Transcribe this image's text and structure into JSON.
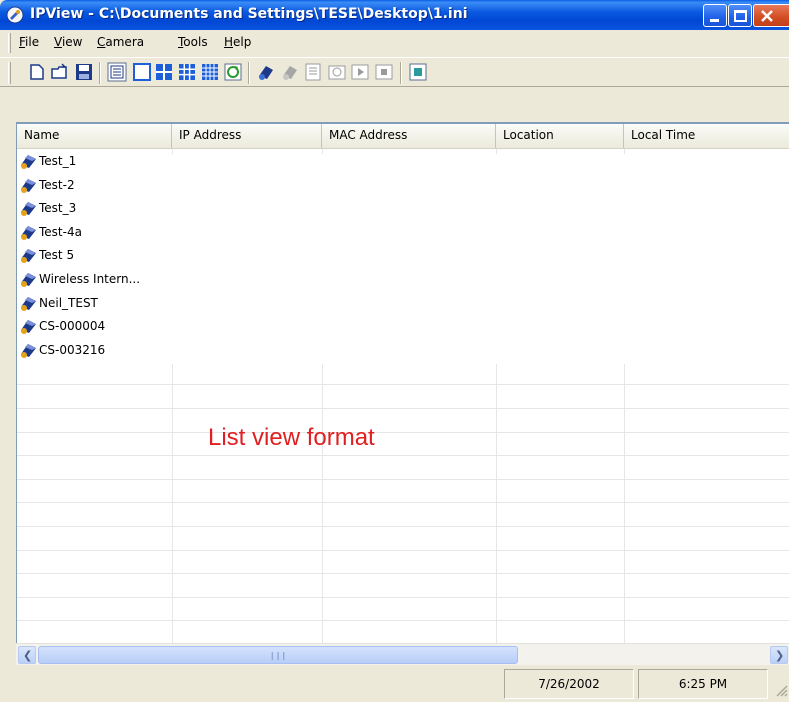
{
  "window": {
    "title": "IPView - C:\\Documents and Settings\\TESE\\Desktop\\1.ini"
  },
  "menu": {
    "items": [
      {
        "label": "File",
        "accel": "F",
        "rest": "ile"
      },
      {
        "label": "View",
        "accel": "V",
        "rest": "iew"
      },
      {
        "label": "Camera",
        "accel": "C",
        "rest": "amera"
      },
      {
        "label": "Tools",
        "accel": "T",
        "rest": "ools"
      },
      {
        "label": "Help",
        "accel": "H",
        "rest": "elp"
      }
    ]
  },
  "toolbar": {
    "buttons": [
      "new-file-icon",
      "open-folder-icon",
      "save-icon",
      "list-view-icon",
      "single-view-icon",
      "quad-view-icon",
      "nine-view-icon",
      "sixteen-view-icon",
      "refresh-icon",
      "connect-camera-icon",
      "disconnect-camera-icon",
      "properties-icon",
      "snapshot-icon",
      "play-icon",
      "stop-icon",
      "settings-icon"
    ]
  },
  "list": {
    "columns": [
      "Name",
      "IP Address",
      "MAC Address",
      "Location",
      "Local Time"
    ],
    "rows": [
      "Test_1",
      "Test-2",
      "Test_3",
      "Test-4a",
      "Test 5",
      "Wireless Intern...",
      "Neil_TEST",
      "CS-000004",
      "CS-003216"
    ]
  },
  "annotation": "List view format",
  "status": {
    "date": "7/26/2002",
    "time": "6:25 PM"
  },
  "colors": {
    "titlebar": "#0a59e0",
    "annotation": "#e02020",
    "face": "#ece9d8"
  }
}
